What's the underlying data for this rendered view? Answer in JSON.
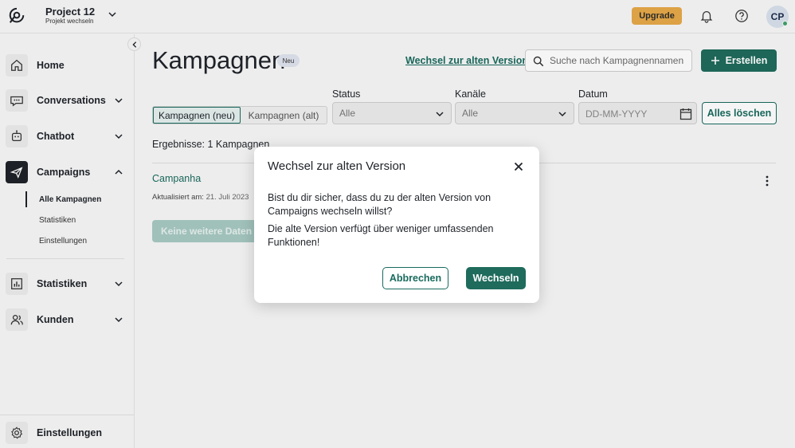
{
  "header": {
    "project_title": "Project 12",
    "project_switch": "Projekt wechseln",
    "upgrade_label": "Upgrade",
    "avatar_initials": "CP"
  },
  "sidebar": {
    "items": [
      {
        "label": "Home",
        "icon": "home-icon"
      },
      {
        "label": "Conversations",
        "icon": "chat-icon"
      },
      {
        "label": "Chatbot",
        "icon": "bot-icon"
      },
      {
        "label": "Campaigns",
        "icon": "megaphone-icon",
        "active": true
      },
      {
        "label": "Statistiken",
        "icon": "chart-icon"
      },
      {
        "label": "Kunden",
        "icon": "users-icon"
      }
    ],
    "campaigns_sub": [
      "Alle Kampagnen",
      "Statistiken",
      "Einstellungen"
    ],
    "settings_label": "Einstellungen"
  },
  "main": {
    "title": "Kampagnen",
    "badge": "Neu",
    "old_version_link": "Wechsel zur alten Version",
    "search_placeholder": "Suche nach Kampagnennamen",
    "create_label": "Erstellen",
    "tabs": [
      "Kampagnen (neu)",
      "Kampagnen (alt)"
    ],
    "filters": {
      "status_label": "Status",
      "status_value": "Alle",
      "channels_label": "Kanäle",
      "channels_value": "Alle",
      "date_label": "Datum",
      "date_placeholder": "DD-MM-YYYY",
      "clear_label": "Alles löschen"
    },
    "results": "Ergebnisse: 1 Kampagnen",
    "campaign": {
      "name": "Campanha",
      "updated_prefix": "Aktualisiert am:",
      "updated_date": "21. Juli 2023"
    },
    "no_more_label": "Keine weitere Daten zu laden"
  },
  "modal": {
    "title": "Wechsel zur alten Version",
    "p1": "Bist du dir sicher, dass du zu der alten Version von Campaigns wechseln willst?",
    "p2": "Die alte Version verfügt über weniger umfassenden Funktionen!",
    "cancel_label": "Abbrechen",
    "confirm_label": "Wechseln"
  },
  "colors": {
    "accent": "#1f6b5c",
    "upgrade": "#e7a948",
    "link": "#1a6b5e"
  }
}
